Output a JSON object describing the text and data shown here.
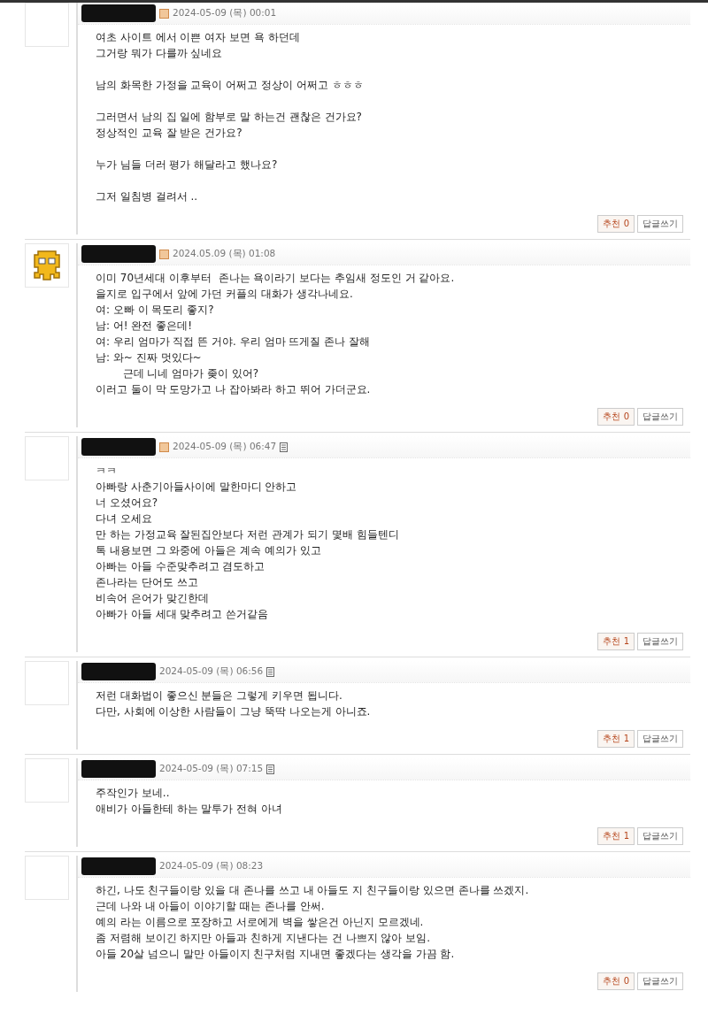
{
  "comments": [
    {
      "avatar": {
        "kind": "blank"
      },
      "badge": true,
      "memo_icon": false,
      "date": "2024-05-09 (목) 00:01",
      "paragraphs": [
        [
          "여초 사이트 에서 이쁜 여자 보면 욕 하던데",
          "그거랑 뭐가 다를까 싶네요"
        ],
        [
          "남의 화목한 가정을 교육이 어쩌고 정상이 어쩌고 ㅎㅎㅎ"
        ],
        [
          "그러면서 남의 집 일에 함부로 말 하는건 괜찮은 건가요?",
          "정상적인 교육 잘 받은 건가요?"
        ],
        [
          "누가 님들 더러 평가 해달라고 했나요?"
        ],
        [
          "그저 일침병 걸려서 .."
        ]
      ],
      "vote": "추천 0",
      "reply": "답글쓰기"
    },
    {
      "avatar": {
        "kind": "pixel-figure"
      },
      "badge": true,
      "memo_icon": false,
      "date": "2024.05.09 (목) 01:08",
      "paragraphs": [
        [
          "이미 70년세대 이후부터  존나는 욕이라기 보다는 추임새 정도인 거 같아요.",
          "을지로 입구에서 앞에 가던 커플의 대화가 생각나네요.",
          "여: 오빠 이 목도리 좋지?",
          "남: 어! 완전 좋은데!",
          "여: 우리 엄마가 직접 뜬 거야. 우리 엄마 뜨게질 존나 잘해",
          "남: 와~ 진짜 멋있다~",
          "        근데 니네 엄마가 좆이 있어?",
          "이러고 둘이 막 도망가고 나 잡아봐라 하고 뛰어 가더군요."
        ]
      ],
      "vote": "추천 0",
      "reply": "답글쓰기"
    },
    {
      "avatar": {
        "kind": "blank"
      },
      "badge": true,
      "memo_icon": true,
      "date": "2024-05-09 (목) 06:47",
      "paragraphs": [
        [
          "ㅋㅋ",
          "아빠랑 사춘기아들사이에 말한마디 안하고",
          "너 오셨어요?",
          "다녀 오세요",
          "만 하는 가정교육 잘된집안보다 저런 관계가 되기 몇배 힘들텐디",
          "톡 내용보면 그 와중에 아들은 계속 예의가 있고",
          "아빠는 아들 수준맞추려고 겸도하고",
          "존나라는 단어도 쓰고",
          "비속어 은어가 맞긴한데",
          "아빠가 아들 세대 맞추려고 쓴거같음"
        ]
      ],
      "vote": "추천 1",
      "reply": "답글쓰기"
    },
    {
      "avatar": {
        "kind": "blank"
      },
      "badge": false,
      "memo_icon": true,
      "date": "2024-05-09 (목) 06:56",
      "paragraphs": [
        [
          "저런 대화법이 좋으신 분들은 그렇게 키우면 됩니다.",
          "다만, 사회에 이상한 사람들이 그냥 뚝딱 나오는게 아니죠."
        ]
      ],
      "vote": "추천 1",
      "reply": "답글쓰기"
    },
    {
      "avatar": {
        "kind": "blank"
      },
      "badge": false,
      "memo_icon": true,
      "date": "2024-05-09 (목) 07:15",
      "paragraphs": [
        [
          "주작인가 보네..",
          "애비가 아들한테 하는 말투가 전혀 아녀"
        ]
      ],
      "vote": "추천 1",
      "reply": "답글쓰기"
    },
    {
      "avatar": {
        "kind": "blank"
      },
      "badge": false,
      "memo_icon": false,
      "date": "2024-05-09 (목) 08:23",
      "paragraphs": [
        [
          "하긴, 나도 친구들이랑 있을 대 존나를 쓰고 내 아들도 지 친구들이랑 있으면 존나를 쓰겠지.",
          "근데 나와 내 아들이 이야기할 때는 존나를 안써.",
          "예의 라는 이름으로 포장하고 서로에게 벽을 쌓은건 아닌지 모르겠네.",
          "좀 저렴해 보이긴 하지만 아들과 친하게 지낸다는 건 나쁘지 않아 보임.",
          "아들 20살 넘으니 말만 아들이지 친구처럼 지내면 좋겠다는 생각을 가끔 함."
        ]
      ],
      "vote": "추천 0",
      "reply": "답글쓰기"
    }
  ]
}
